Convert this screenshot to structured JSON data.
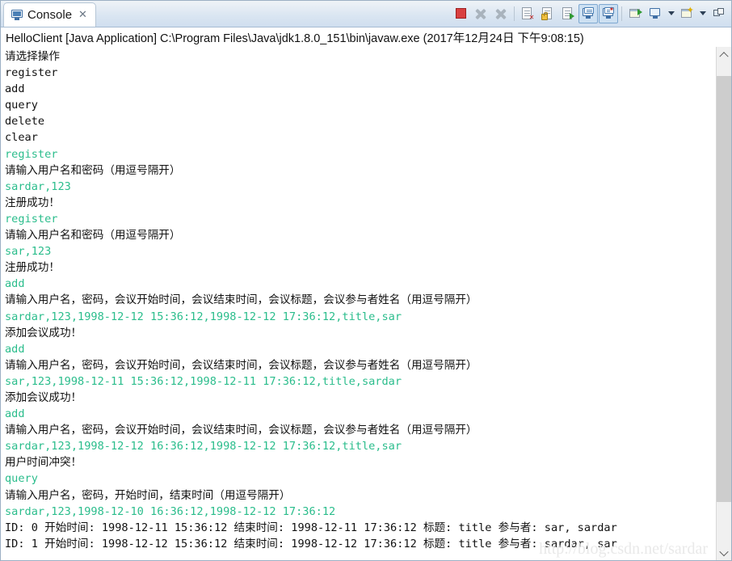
{
  "window": {
    "title": "Console"
  },
  "tab": {
    "label": "Console",
    "close_glyph": "✕",
    "icon": "console-icon"
  },
  "toolbar": {
    "buttons": [
      {
        "name": "terminate-button",
        "label": "Terminate",
        "state": "enabled"
      },
      {
        "name": "remove-launch-button",
        "label": "Remove Launch",
        "state": "disabled"
      },
      {
        "name": "remove-all-terminated-button",
        "label": "Remove All Terminated Launches",
        "state": "disabled"
      },
      {
        "name": "clear-console-button",
        "label": "Clear Console",
        "state": "enabled"
      },
      {
        "name": "scroll-lock-button",
        "label": "Scroll Lock",
        "state": "enabled"
      },
      {
        "name": "word-wrap-button",
        "label": "Word Wrap",
        "state": "enabled"
      },
      {
        "name": "show-console-output-button",
        "label": "Show Console When Standard Out Changes",
        "state": "active"
      },
      {
        "name": "show-console-error-button",
        "label": "Show Console When Standard Error Changes",
        "state": "active"
      },
      {
        "name": "pin-console-button",
        "label": "Pin Console",
        "state": "enabled"
      },
      {
        "name": "display-selected-console-button",
        "label": "Display Selected Console",
        "state": "enabled"
      },
      {
        "name": "open-console-button",
        "label": "Open Console",
        "state": "enabled"
      },
      {
        "name": "minimize-maximize-button",
        "label": "Minimize / Restore",
        "state": "enabled"
      }
    ]
  },
  "launch": {
    "line": "HelloClient [Java Application] C:\\Program Files\\Java\\jdk1.8.0_151\\bin\\javaw.exe (2017年12月24日 下午9:08:15)"
  },
  "console": {
    "watermark": "http://blog.csdn.net/sardar",
    "lines": [
      {
        "text": "请选择操作",
        "kind": "out"
      },
      {
        "text": "register",
        "kind": "out"
      },
      {
        "text": "add",
        "kind": "out"
      },
      {
        "text": "query",
        "kind": "out"
      },
      {
        "text": "delete",
        "kind": "out"
      },
      {
        "text": "clear",
        "kind": "out"
      },
      {
        "text": "register",
        "kind": "in"
      },
      {
        "text": "请输入用户名和密码（用逗号隔开）",
        "kind": "out"
      },
      {
        "text": "sardar,123",
        "kind": "in"
      },
      {
        "text": "注册成功！",
        "kind": "out"
      },
      {
        "text": "register",
        "kind": "in"
      },
      {
        "text": "请输入用户名和密码（用逗号隔开）",
        "kind": "out"
      },
      {
        "text": "sar,123",
        "kind": "in"
      },
      {
        "text": "注册成功！",
        "kind": "out"
      },
      {
        "text": "add",
        "kind": "in"
      },
      {
        "text": "请输入用户名，密码，会议开始时间，会议结束时间，会议标题，会议参与者姓名（用逗号隔开）",
        "kind": "out"
      },
      {
        "text": "sardar,123,1998-12-12 15:36:12,1998-12-12 17:36:12,title,sar",
        "kind": "in"
      },
      {
        "text": "添加会议成功！",
        "kind": "out"
      },
      {
        "text": "add",
        "kind": "in"
      },
      {
        "text": "请输入用户名，密码，会议开始时间，会议结束时间，会议标题，会议参与者姓名（用逗号隔开）",
        "kind": "out"
      },
      {
        "text": "sar,123,1998-12-11 15:36:12,1998-12-11 17:36:12,title,sardar",
        "kind": "in"
      },
      {
        "text": "添加会议成功！",
        "kind": "out"
      },
      {
        "text": "add",
        "kind": "in"
      },
      {
        "text": "请输入用户名，密码，会议开始时间，会议结束时间，会议标题，会议参与者姓名（用逗号隔开）",
        "kind": "out"
      },
      {
        "text": "sardar,123,1998-12-12 16:36:12,1998-12-12 17:36:12,title,sar",
        "kind": "in"
      },
      {
        "text": "用户时间冲突！",
        "kind": "out"
      },
      {
        "text": "query",
        "kind": "in"
      },
      {
        "text": "请输入用户名，密码，开始时间，结束时间（用逗号隔开）",
        "kind": "out"
      },
      {
        "text": "sardar,123,1998-12-10 16:36:12,1998-12-12 17:36:12",
        "kind": "in"
      },
      {
        "text": "ID: 0 开始时间: 1998-12-11 15:36:12 结束时间: 1998-12-11 17:36:12 标题: title 参与者: sar, sardar",
        "kind": "out"
      },
      {
        "text": "ID: 1 开始时间: 1998-12-12 15:36:12 结束时间: 1998-12-12 17:36:12 标题: title 参与者: sardar, sar",
        "kind": "out"
      }
    ]
  },
  "scrollbar": {
    "up_label": "Scroll up",
    "down_label": "Scroll down",
    "thumb_top_pct": 3,
    "thumb_height_pct": 88
  },
  "colors": {
    "input_text": "#2bbd8c",
    "output_text": "#111111",
    "tab_active_bg": "#ffffff",
    "toolbar_active_bg": "#cde0f2"
  }
}
